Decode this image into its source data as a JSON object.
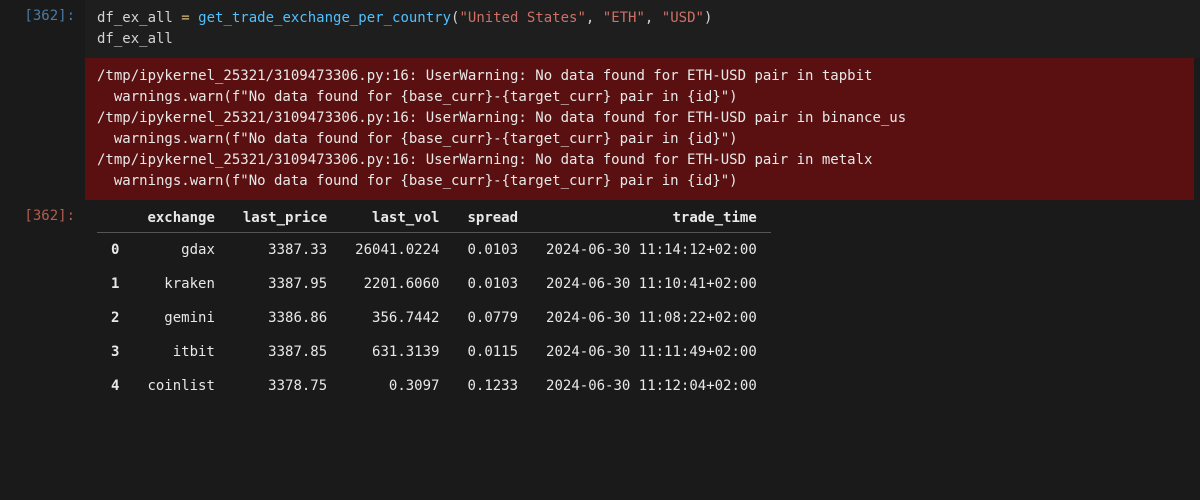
{
  "input_prompt": "[362]:",
  "output_prompt": "[362]:",
  "code_line1": {
    "var": "df_ex_all",
    "op": " = ",
    "fn": "get_trade_exchange_per_country",
    "open": "(",
    "arg1": "\"United States\"",
    "sep1": ", ",
    "arg2": "\"ETH\"",
    "sep2": ", ",
    "arg3": "\"USD\"",
    "close": ")"
  },
  "code_line2": "df_ex_all",
  "warnings": [
    "/tmp/ipykernel_25321/3109473306.py:16: UserWarning: No data found for ETH-USD pair in tapbit",
    "  warnings.warn(f\"No data found for {base_curr}-{target_curr} pair in {id}\")",
    "/tmp/ipykernel_25321/3109473306.py:16: UserWarning: No data found for ETH-USD pair in binance_us",
    "  warnings.warn(f\"No data found for {base_curr}-{target_curr} pair in {id}\")",
    "/tmp/ipykernel_25321/3109473306.py:16: UserWarning: No data found for ETH-USD pair in metalx",
    "  warnings.warn(f\"No data found for {base_curr}-{target_curr} pair in {id}\")"
  ],
  "table": {
    "columns": [
      "",
      "exchange",
      "last_price",
      "last_vol",
      "spread",
      "trade_time"
    ],
    "rows": [
      {
        "idx": "0",
        "exchange": "gdax",
        "last_price": "3387.33",
        "last_vol": "26041.0224",
        "spread": "0.0103",
        "trade_time": "2024-06-30 11:14:12+02:00"
      },
      {
        "idx": "1",
        "exchange": "kraken",
        "last_price": "3387.95",
        "last_vol": "2201.6060",
        "spread": "0.0103",
        "trade_time": "2024-06-30 11:10:41+02:00"
      },
      {
        "idx": "2",
        "exchange": "gemini",
        "last_price": "3386.86",
        "last_vol": "356.7442",
        "spread": "0.0779",
        "trade_time": "2024-06-30 11:08:22+02:00"
      },
      {
        "idx": "3",
        "exchange": "itbit",
        "last_price": "3387.85",
        "last_vol": "631.3139",
        "spread": "0.0115",
        "trade_time": "2024-06-30 11:11:49+02:00"
      },
      {
        "idx": "4",
        "exchange": "coinlist",
        "last_price": "3378.75",
        "last_vol": "0.3097",
        "spread": "0.1233",
        "trade_time": "2024-06-30 11:12:04+02:00"
      }
    ]
  }
}
